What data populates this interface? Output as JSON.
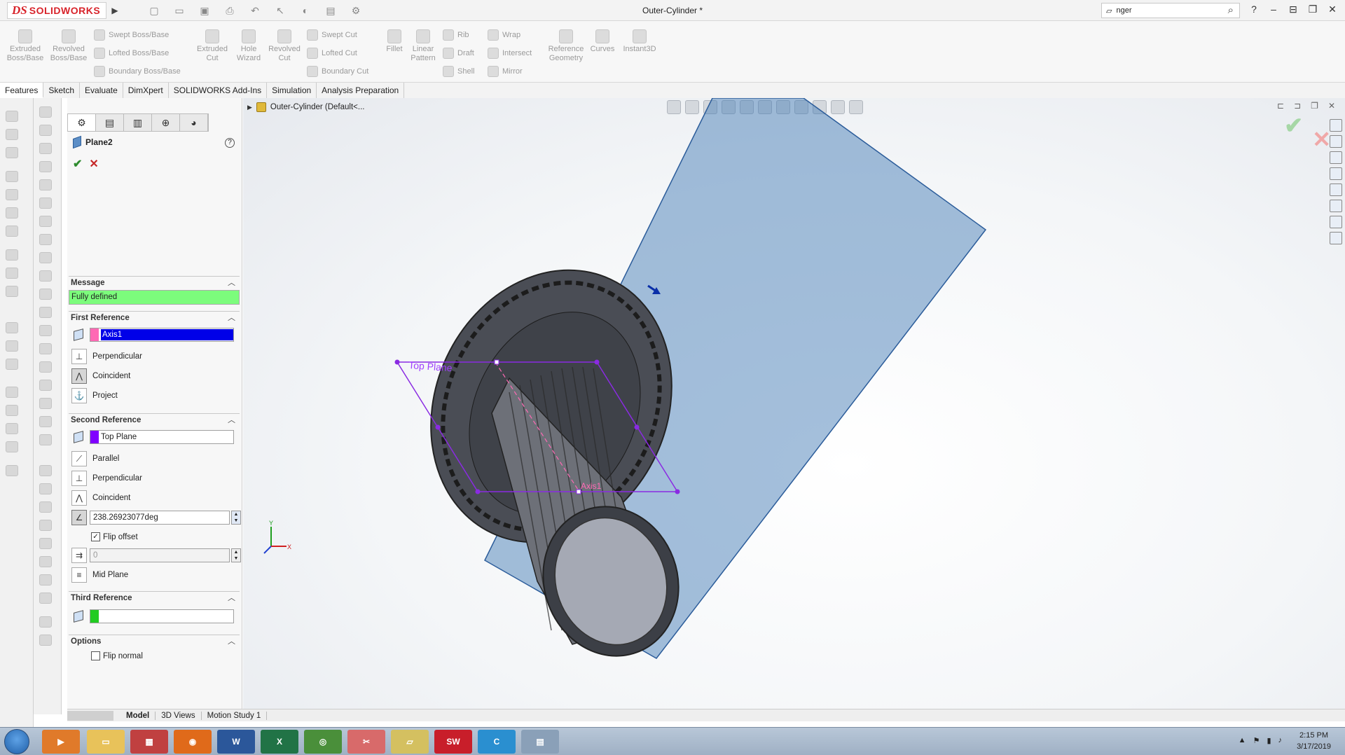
{
  "app": {
    "brand_ds": "DS",
    "brand_name": "SOLIDWORKS",
    "document_title": "Outer-Cylinder *",
    "search_value": "nger"
  },
  "commands": {
    "extruded_boss": "Extruded Boss/Base",
    "revolved_boss": "Revolved Boss/Base",
    "swept_boss": "Swept Boss/Base",
    "lofted_boss": "Lofted Boss/Base",
    "boundary_boss": "Boundary Boss/Base",
    "extruded_cut": "Extruded Cut",
    "hole_wizard": "Hole Wizard",
    "revolved_cut": "Revolved Cut",
    "swept_cut": "Swept Cut",
    "lofted_cut": "Lofted Cut",
    "boundary_cut": "Boundary Cut",
    "fillet": "Fillet",
    "linear_pattern": "Linear Pattern",
    "rib": "Rib",
    "draft": "Draft",
    "shell": "Shell",
    "wrap": "Wrap",
    "intersect": "Intersect",
    "mirror": "Mirror",
    "reference_geometry": "Reference Geometry",
    "curves": "Curves",
    "instant3d": "Instant3D"
  },
  "tabs": [
    "Features",
    "Sketch",
    "Evaluate",
    "DimXpert",
    "SOLIDWORKS Add-Ins",
    "Simulation",
    "Analysis Preparation"
  ],
  "property_manager": {
    "title": "Plane2",
    "message_header": "Message",
    "message_text": "Fully defined",
    "first_ref": {
      "header": "First Reference",
      "selection": "Axis1",
      "color": "#ff69b4",
      "options": [
        "Perpendicular",
        "Coincident",
        "Project"
      ]
    },
    "second_ref": {
      "header": "Second Reference",
      "selection": "Top Plane",
      "color": "#8000ff",
      "options": [
        "Parallel",
        "Perpendicular",
        "Coincident"
      ],
      "angle_value": "238.26923077deg",
      "flip_offset": "Flip offset",
      "offset_value": "0",
      "mid_plane": "Mid Plane"
    },
    "third_ref": {
      "header": "Third Reference",
      "selection": "",
      "color": "#22cc22"
    },
    "options": {
      "header": "Options",
      "flip_normal": "Flip normal"
    }
  },
  "bottom_tabs": [
    "Model",
    "3D Views",
    "Motion Study 1"
  ],
  "graphics": {
    "tree_root": "Outer-Cylinder  (Default<...",
    "plane_label": "Top Plane",
    "axis_label": "Axis1",
    "plane_color": "#4a7fb8",
    "sketch_color": "#8a2be2"
  },
  "taskbar": {
    "time": "2:15 PM",
    "date": "3/17/2019",
    "apps": [
      "media",
      "explorer",
      "apps",
      "firefox",
      "word",
      "excel",
      "chrome",
      "snip",
      "folder",
      "solidworks",
      "camtasia",
      "calculator"
    ]
  }
}
